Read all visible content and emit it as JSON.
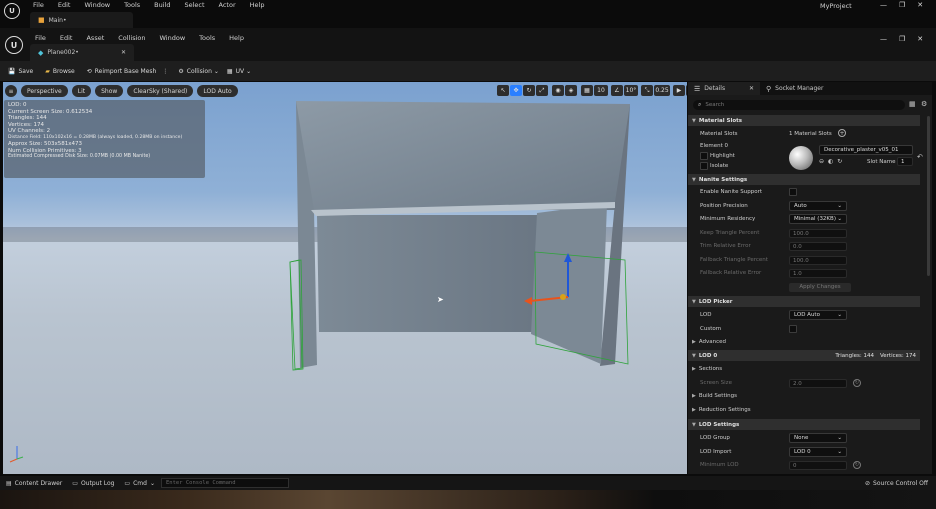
{
  "top_menu": [
    "File",
    "Edit",
    "Window",
    "Tools",
    "Build",
    "Select",
    "Actor",
    "Help"
  ],
  "project_name": "MyProject",
  "main_tab": "Main•",
  "editor_menu": [
    "File",
    "Edit",
    "Asset",
    "Collision",
    "Window",
    "Tools",
    "Help"
  ],
  "asset_tab": "Plane002•",
  "toolbar": {
    "save": "Save",
    "browse": "Browse",
    "reimport": "Reimport Base Mesh",
    "collision": "Collision",
    "uv": "UV"
  },
  "viewport_bar": {
    "perspective": "Perspective",
    "lit": "Lit",
    "show": "Show",
    "sky": "ClearSky (Shared)",
    "lod": "LOD Auto",
    "grid": "10",
    "angle": "10°",
    "scale": "0.25",
    "speed": "4"
  },
  "overlay_lines": [
    "LOD: 0",
    "Current Screen Size: 0.612534",
    "Triangles: 144",
    "Vertices: 174",
    "UV Channels: 2",
    "Distance Field: 110x102x16 = 0.28MB (always loaded, 0.28MB on instance)",
    "Approx Size: 503x581x473",
    "Num Collision Primitives: 3",
    "Estimated Compressed Disk Size: 0.07MB (0.00 MB Nanite)"
  ],
  "details": {
    "tab": "Details",
    "socket_tab": "Socket Manager",
    "search_placeholder": "Search",
    "material_slots_header": "Material Slots",
    "material_slots_label": "Material Slots",
    "material_slots_count": "1 Material Slots",
    "element": "Element 0",
    "highlight": "Highlight",
    "isolate": "Isolate",
    "material_name": "Decorative_plaster_v05_01",
    "slot_name_label": "Slot Name",
    "slot_name_value": "1",
    "nanite_header": "Nanite Settings",
    "enable_nanite": "Enable Nanite Support",
    "position_precision": "Position Precision",
    "position_precision_value": "Auto",
    "min_residency": "Minimum Residency",
    "min_residency_value": "Minimal (32KB)",
    "keep_tri": "Keep Triangle Percent",
    "keep_tri_value": "100.0",
    "trim_error": "Trim Relative Error",
    "trim_error_value": "0.0",
    "fallback_tri": "Fallback Triangle Percent",
    "fallback_tri_value": "100.0",
    "fallback_err": "Fallback Relative Error",
    "fallback_err_value": "1.0",
    "apply": "Apply Changes",
    "lod_picker_header": "LOD Picker",
    "lod": "LOD",
    "lod_value": "LOD Auto",
    "custom": "Custom",
    "advanced": "Advanced",
    "lod0_header": "LOD 0",
    "triangles": "Triangles: 144",
    "vertices": "Vertices: 174",
    "sections": "Sections",
    "screen_size": "Screen Size",
    "screen_size_value": "2.0",
    "build_settings": "Build Settings",
    "reduction_settings": "Reduction Settings",
    "lod_settings_header": "LOD Settings",
    "lod_group": "LOD Group",
    "lod_group_value": "None",
    "lod_import": "LOD Import",
    "lod_import_value": "LOD 0",
    "min_lod": "Minimum LOD",
    "min_lod_value": "0"
  },
  "status": {
    "content_drawer": "Content Drawer",
    "output_log": "Output Log",
    "cmd": "Cmd",
    "console_placeholder": "Enter Console Command",
    "source_control": "Source Control Off"
  },
  "colors": {
    "accent": "#2a7fff",
    "sky_top": "#6f95c4",
    "ground": "#b9c2cc",
    "panel": "#1a1a1a"
  }
}
